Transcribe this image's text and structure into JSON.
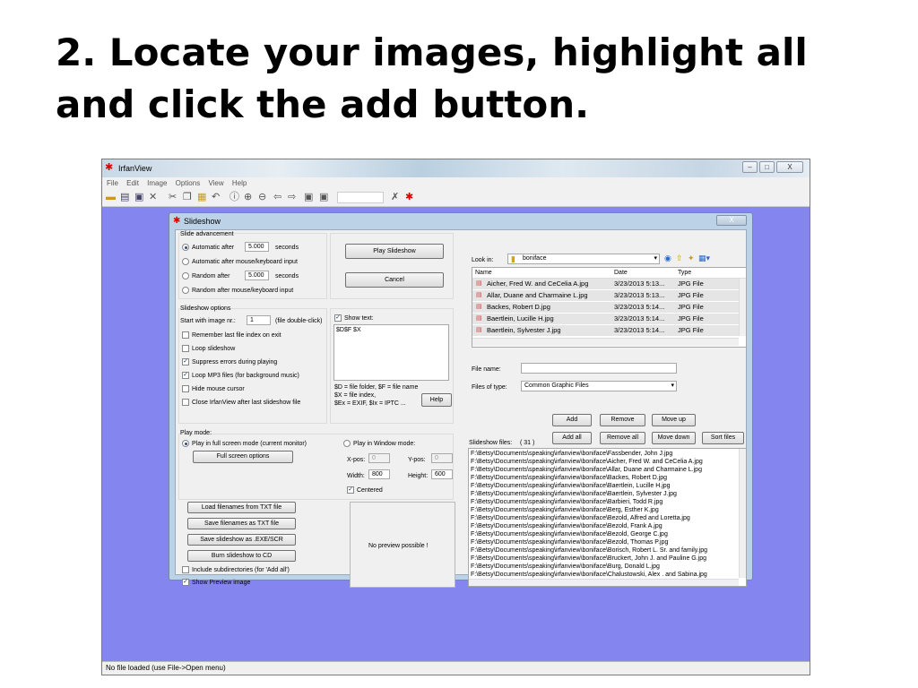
{
  "slide": {
    "title": "2.  Locate your images, highlight all and click the add button."
  },
  "app": {
    "title": "IrfanView",
    "menu": [
      "File",
      "Edit",
      "Image",
      "Options",
      "View",
      "Help"
    ],
    "status": "No file loaded (use File->Open menu)",
    "window_buttons": {
      "minimize": "–",
      "maximize": "□",
      "close": "X"
    },
    "toolbar_icons": [
      "open-icon",
      "slideshow-icon",
      "save-icon",
      "delete-icon",
      "cut-icon",
      "copy-icon",
      "paste-icon",
      "undo-icon",
      "info-icon",
      "zoom-in-icon",
      "zoom-out-icon",
      "previous-icon",
      "next-icon",
      "first-page-icon",
      "last-page-icon",
      "settings-icon",
      "irfanview-logo-icon"
    ]
  },
  "dialog": {
    "title": "Slideshow",
    "close": "X",
    "slide_adv": {
      "label": "Slide advancement",
      "auto_after": "Automatic after",
      "auto_value": "5.000",
      "seconds": "seconds",
      "auto_mouse": "Automatic after mouse/keyboard input",
      "random_after": "Random   after",
      "random_value": "5.000",
      "random_mouse": "Random   after mouse/keyboard input"
    },
    "play_button": "Play Slideshow",
    "cancel_button": "Cancel",
    "options": {
      "label": "Slideshow options",
      "start_label": "Start with image nr.:",
      "start_value": "1",
      "start_hint": "(file double-click)",
      "remember": "Remember last file index on exit",
      "loop": "Loop slideshow",
      "suppress": "Suppress errors during playing",
      "loop_mp3": "Loop MP3 files (for background music)",
      "hide_cursor": "Hide mouse cursor",
      "close_after": "Close IrfanView after last slideshow file"
    },
    "show_text": {
      "label": "Show text:",
      "value": "$D$F $X",
      "help1": "$D = file folder, $F = file name",
      "help2": "$X = file index,",
      "help3": "$Ex = EXIF, $Ix = IPTC ...",
      "help_button": "Help"
    },
    "play_mode": {
      "label": "Play mode:",
      "fullscreen": "Play in full screen mode (current monitor)",
      "fs_options": "Full screen options",
      "window": "Play in Window mode:",
      "xpos_label": "X-pos:",
      "xpos": "0",
      "ypos_label": "Y-pos:",
      "ypos": "0",
      "width_label": "Width:",
      "width": "800",
      "height_label": "Height:",
      "height": "600",
      "centered": "Centered"
    },
    "buttons": {
      "load_txt": "Load filenames from TXT file",
      "save_txt": "Save filenames as TXT file",
      "save_exe": "Save slideshow as .EXE/SCR",
      "burn": "Burn slideshow to CD"
    },
    "include_sub": "Include subdirectories (for 'Add all')",
    "show_preview": "Show Preview image",
    "preview": "No preview possible !",
    "browser": {
      "look_in": "Look in:",
      "folder": "boniface",
      "columns": {
        "name": "Name",
        "date": "Date",
        "type": "Type"
      },
      "files": [
        {
          "name": "Aicher, Fred W. and CeCelia A.jpg",
          "date": "3/23/2013 5:13...",
          "type": "JPG File"
        },
        {
          "name": "Allar, Duane and Charmaine L.jpg",
          "date": "3/23/2013 5:13...",
          "type": "JPG File"
        },
        {
          "name": "Backes, Robert D.jpg",
          "date": "3/23/2013 5:14...",
          "type": "JPG File"
        },
        {
          "name": "Baertlein, Lucille H.jpg",
          "date": "3/23/2013 5:14...",
          "type": "JPG File"
        },
        {
          "name": "Baertlein, Sylvester J.jpg",
          "date": "3/23/2013 5:14...",
          "type": "JPG File"
        }
      ],
      "file_name_label": "File name:",
      "file_name": "",
      "files_type_label": "Files of type:",
      "files_type": "Common Graphic Files"
    },
    "actions": {
      "add": "Add",
      "remove": "Remove",
      "move_up": "Move up",
      "add_all": "Add all",
      "remove_all": "Remove all",
      "move_down": "Move down",
      "sort_files": "Sort files"
    },
    "slideshow_files": {
      "label": "Slideshow files:",
      "count": "( 31 )",
      "items": [
        "F:\\Betsy\\Documents\\speaking\\irfanview\\boniface\\Fassbender, John J.jpg",
        "F:\\Betsy\\Documents\\speaking\\irfanview\\boniface\\Aicher, Fred W. and CeCelia A.jpg",
        "F:\\Betsy\\Documents\\speaking\\irfanview\\boniface\\Allar, Duane and Charmaine L.jpg",
        "F:\\Betsy\\Documents\\speaking\\irfanview\\boniface\\Backes, Robert D.jpg",
        "F:\\Betsy\\Documents\\speaking\\irfanview\\boniface\\Baertlein, Lucille H.jpg",
        "F:\\Betsy\\Documents\\speaking\\irfanview\\boniface\\Baertlein, Sylvester J.jpg",
        "F:\\Betsy\\Documents\\speaking\\irfanview\\boniface\\Barbieri, Todd R.jpg",
        "F:\\Betsy\\Documents\\speaking\\irfanview\\boniface\\Berg, Esther K.jpg",
        "F:\\Betsy\\Documents\\speaking\\irfanview\\boniface\\Bezold, Alfred and Loretta.jpg",
        "F:\\Betsy\\Documents\\speaking\\irfanview\\boniface\\Bezold, Frank A.jpg",
        "F:\\Betsy\\Documents\\speaking\\irfanview\\boniface\\Bezold, George C.jpg",
        "F:\\Betsy\\Documents\\speaking\\irfanview\\boniface\\Bezold, Thomas P.jpg",
        "F:\\Betsy\\Documents\\speaking\\irfanview\\boniface\\Borisch, Robert L. Sr. and family.jpg",
        "F:\\Betsy\\Documents\\speaking\\irfanview\\boniface\\Bruckert, John J. and Pauline G.jpg",
        "F:\\Betsy\\Documents\\speaking\\irfanview\\boniface\\Burg, Donald L.jpg",
        "F:\\Betsy\\Documents\\speaking\\irfanview\\boniface\\Chalustowski, Alex . and Sabina.jpg"
      ]
    }
  }
}
